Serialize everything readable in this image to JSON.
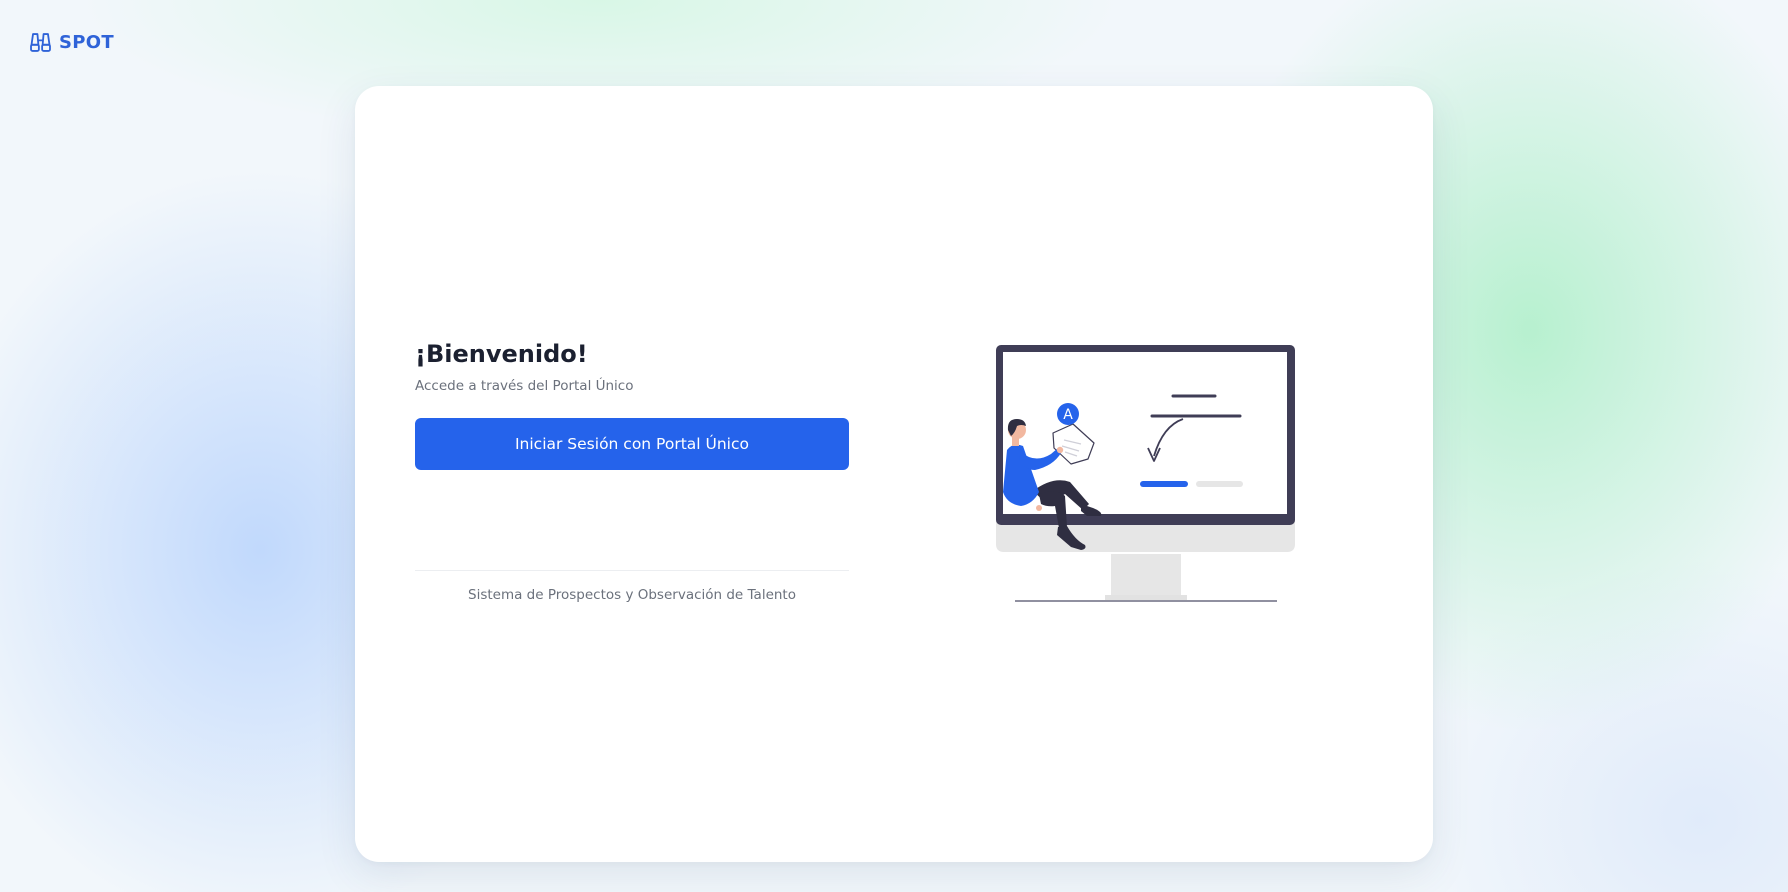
{
  "brand": {
    "name": "SPOT",
    "icon": "binoculars-icon",
    "color": "#2f63d8"
  },
  "login": {
    "title": "¡Bienvenido!",
    "subtitle": "Accede a través del Portal Único",
    "button_label": "Iniciar Sesión con Portal Único",
    "footer": "Sistema de Prospectos y Observación de Talento"
  },
  "illustration": {
    "badge_letter": "A",
    "icon": "login-illustration"
  },
  "colors": {
    "primary": "#2563eb",
    "monitor_frame": "#3f3d56",
    "stand": "#e6e6e6"
  }
}
